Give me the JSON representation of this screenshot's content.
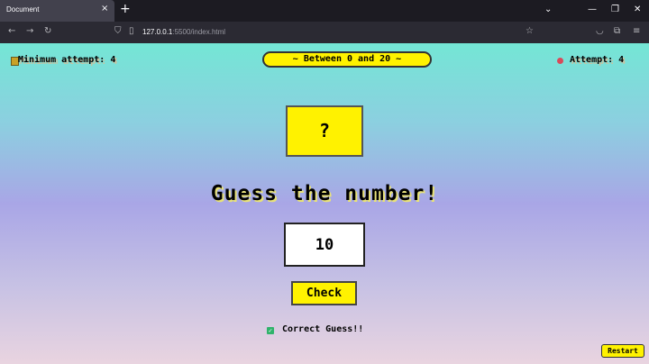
{
  "browser": {
    "tab_title": "Document",
    "tab_close_icon": "×",
    "new_tab_icon": "+",
    "url_host": "127.0.0.1",
    "url_rest": ":5500/index.html",
    "controls": {
      "dropdown": "⌄",
      "minimize": "—",
      "restore": "❐",
      "close": "✕"
    }
  },
  "game": {
    "min_attempt_label": "Minimum attempt: 4",
    "range_label": "~ Between 0 and 20 ~",
    "attempt_label": "Attempt: 4",
    "secret_display": "?",
    "headline": "Guess the number!",
    "guess_value": "10",
    "check_label": "Check",
    "status_message": "Correct Guess!!",
    "restart_label": "Restart"
  },
  "colors": {
    "accent_yellow": "#fff200",
    "gradient_top": "#74e6d5",
    "gradient_bottom": "#e9d4e0",
    "success": "#2fb36b"
  }
}
